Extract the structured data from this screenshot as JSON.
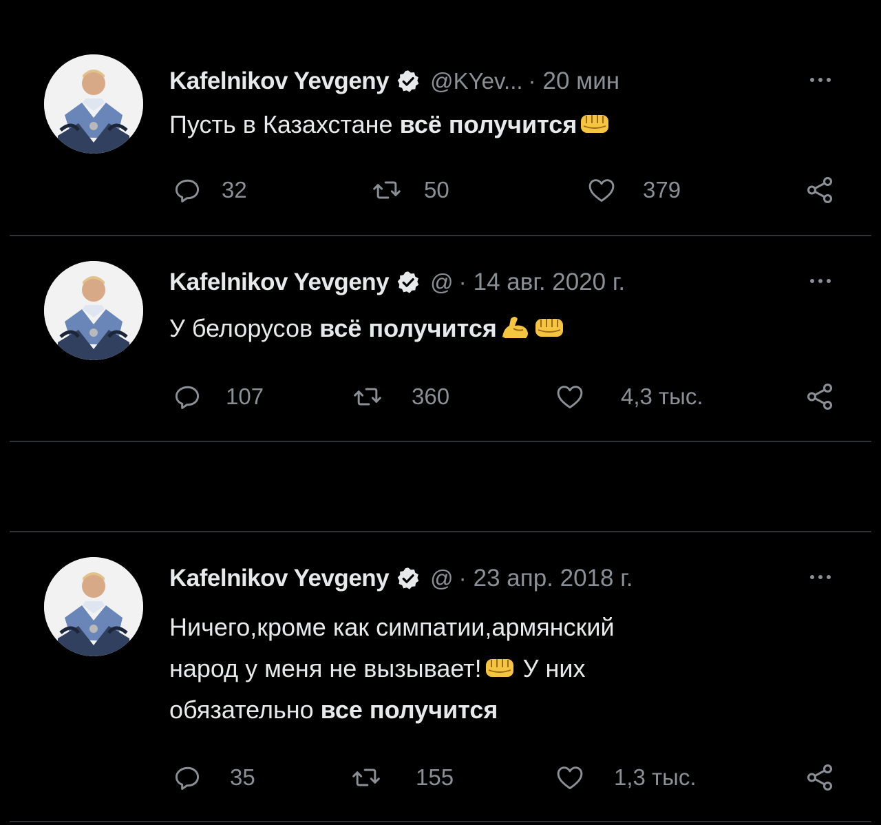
{
  "colors": {
    "background": "#000000",
    "text": "#e7e9ea",
    "muted": "#8b9096",
    "divider": "#2f3336",
    "verified": "#e7e9ea"
  },
  "tweets": [
    {
      "name": "Kafelnikov Yevgeny",
      "handle": "@KYev...",
      "separator": "·",
      "time": "20 мин",
      "text_before": "Пусть в Казахстане ",
      "text_bold": "всё получится",
      "emojis": [
        "fist-icon"
      ],
      "replies": "32",
      "retweets": "50",
      "likes": "379"
    },
    {
      "name": "Kafelnikov Yevgeny",
      "handle": "@",
      "separator": "·",
      "time": "14 авг. 2020 г.",
      "text_before": "У белорусов ",
      "text_bold": "всё получится",
      "emojis": [
        "flexed-biceps-icon",
        "fist-icon"
      ],
      "replies": "107",
      "retweets": "360",
      "likes": "4,3 тыс."
    },
    {
      "name": "Kafelnikov Yevgeny",
      "handle": "@",
      "separator": "·",
      "time": "23 апр. 2018 г.",
      "line1": "Ничего,кроме как симпатии,армянский",
      "line2_before": "народ у меня не вызывает!",
      "line2_after": " У них",
      "line3_before": "обязательно ",
      "text_bold": "все получится",
      "emojis": [
        "fist-icon"
      ],
      "replies": "35",
      "retweets": "155",
      "likes": "1,3 тыс."
    }
  ]
}
